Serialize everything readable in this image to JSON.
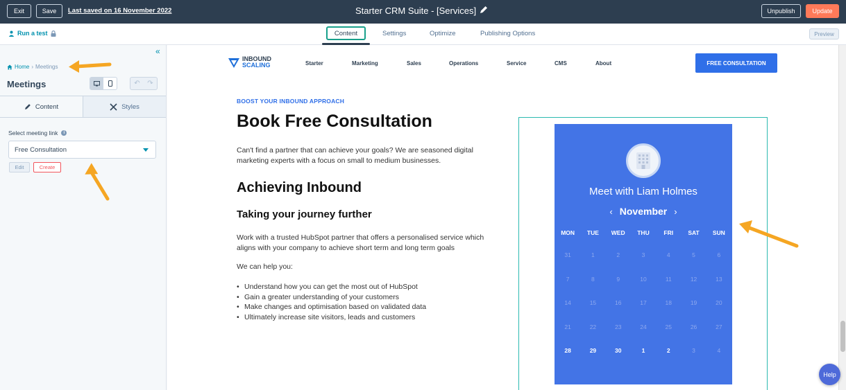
{
  "topbar": {
    "exit_label": "Exit",
    "save_label": "Save",
    "last_saved": "Last saved on 16 November 2022",
    "title": "Starter CRM Suite - [Services]",
    "unpublish_label": "Unpublish",
    "update_label": "Update"
  },
  "subbar": {
    "run_test": "Run a test",
    "tabs": [
      {
        "label": "Content",
        "active": true
      },
      {
        "label": "Settings"
      },
      {
        "label": "Optimize"
      },
      {
        "label": "Publishing Options"
      }
    ],
    "preview_label": "Preview"
  },
  "sidebar": {
    "breadcrumb_home": "Home",
    "breadcrumb_sep": "›",
    "breadcrumb_current": "Meetings",
    "title": "Meetings",
    "tabs": [
      {
        "label": "Content"
      },
      {
        "label": "Styles"
      }
    ],
    "meeting_link_label": "Select meeting link",
    "meeting_link_value": "Free Consultation",
    "edit_label": "Edit",
    "create_label": "Create"
  },
  "site": {
    "logo_line1": "INBOUND",
    "logo_line2": "SCALING",
    "nav": [
      "Starter",
      "Marketing",
      "Sales",
      "Operations",
      "Service",
      "CMS",
      "About"
    ],
    "cta": "FREE CONSULTATION"
  },
  "content": {
    "eyebrow": "BOOST YOUR INBOUND APPROACH",
    "heading": "Book Free Consultation",
    "intro": "Can't find a partner that can achieve your goals? We are seasoned digital marketing experts with a focus on small to medium businesses.",
    "subheading": "Achieving Inbound",
    "subheading2": "Taking your journey further",
    "body": "Work with a trusted HubSpot partner that offers a personalised service which aligns with your company to achieve short term and long term goals",
    "help_intro": "We can help you:",
    "bullets": [
      "Understand how you can get the most out of HubSpot",
      "Gain a greater understanding of your customers",
      "Make changes and optimisation based on validated data",
      "Ultimately increase site visitors, leads and customers"
    ]
  },
  "meeting": {
    "name": "Meet with Liam Holmes",
    "month": "November",
    "days_of_week": [
      "MON",
      "TUE",
      "WED",
      "THU",
      "FRI",
      "SAT",
      "SUN"
    ],
    "weeks": [
      [
        {
          "d": "31"
        },
        {
          "d": "1"
        },
        {
          "d": "2"
        },
        {
          "d": "3"
        },
        {
          "d": "4"
        },
        {
          "d": "5"
        },
        {
          "d": "6"
        }
      ],
      [
        {
          "d": "7"
        },
        {
          "d": "8"
        },
        {
          "d": "9"
        },
        {
          "d": "10"
        },
        {
          "d": "11"
        },
        {
          "d": "12"
        },
        {
          "d": "13"
        }
      ],
      [
        {
          "d": "14"
        },
        {
          "d": "15"
        },
        {
          "d": "16"
        },
        {
          "d": "17"
        },
        {
          "d": "18"
        },
        {
          "d": "19"
        },
        {
          "d": "20"
        }
      ],
      [
        {
          "d": "21"
        },
        {
          "d": "22"
        },
        {
          "d": "23"
        },
        {
          "d": "24"
        },
        {
          "d": "25"
        },
        {
          "d": "26"
        },
        {
          "d": "27"
        }
      ],
      [
        {
          "d": "28",
          "available": true
        },
        {
          "d": "29",
          "available": true
        },
        {
          "d": "30",
          "available": true
        },
        {
          "d": "1",
          "available": true
        },
        {
          "d": "2",
          "available": true
        },
        {
          "d": "3"
        },
        {
          "d": "4"
        }
      ]
    ]
  },
  "help_label": "Help",
  "colors": {
    "topbar": "#2d3e50",
    "accent_teal": "#0091ae",
    "update_orange": "#ff7a59",
    "cta_blue": "#2f6fe8",
    "calendar_blue": "#4374e6",
    "annotation_arrow": "#f5a623"
  }
}
